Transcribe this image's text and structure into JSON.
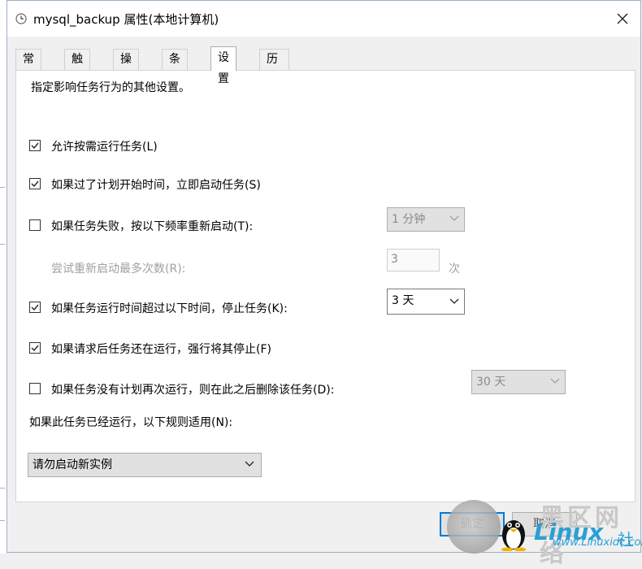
{
  "window": {
    "title": "mysql_backup 属性(本地计算机)",
    "icons": {
      "app": "clock-icon",
      "close": "close-icon"
    }
  },
  "tabs": [
    {
      "label": "常规"
    },
    {
      "label": "触发器"
    },
    {
      "label": "操作"
    },
    {
      "label": "条件"
    },
    {
      "label": "设置",
      "active": true
    },
    {
      "label": "历史记录(已禁用)"
    }
  ],
  "settings": {
    "description": "指定影响任务行为的其他设置。",
    "allow_on_demand": {
      "label": "允许按需运行任务(L)",
      "checked": true
    },
    "run_asap_missed": {
      "label": "如果过了计划开始时间，立即启动任务(S)",
      "checked": true
    },
    "restart_on_fail": {
      "label": "如果任务失败，按以下频率重新启动(T):",
      "checked": false,
      "interval": "1 分钟"
    },
    "restart_attempts": {
      "label": "尝试重新启动最多次数(R):",
      "value": "3",
      "unit": "次"
    },
    "stop_if_runs_longer": {
      "label": "如果任务运行时间超过以下时间，停止任务(K):",
      "checked": true,
      "duration": "3 天"
    },
    "force_stop": {
      "label": "如果请求后任务还在运行，强行将其停止(F)",
      "checked": true
    },
    "delete_if_not_scheduled": {
      "label": "如果任务没有计划再次运行，则在此之后删除该任务(D):",
      "checked": false,
      "after": "30 天"
    },
    "rule_label": "如果此任务已经运行，以下规则适用(N):",
    "rule_value": "请勿启动新实例"
  },
  "buttons": {
    "ok": "确定",
    "cancel": "取消"
  },
  "watermark": {
    "top": "黑区网络",
    "linux": "Linux",
    "she": "社",
    "url": "www.Linuxidc.com"
  },
  "colors": {
    "accent": "#0078d7",
    "panel": "#ffffff",
    "chrome": "#f0f0f0"
  }
}
